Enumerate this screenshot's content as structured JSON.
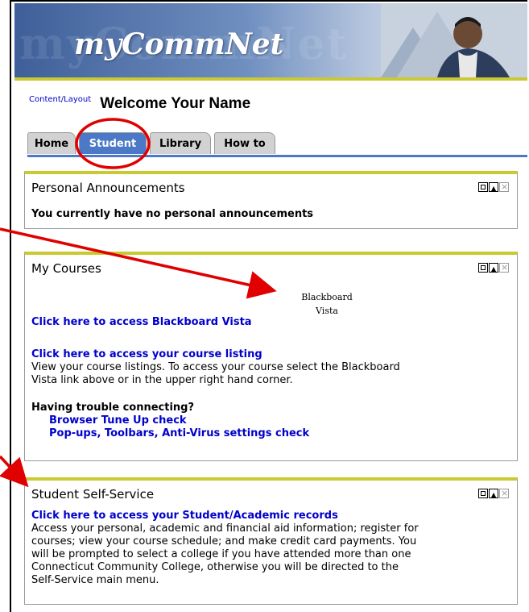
{
  "header": {
    "logo_text": "myCommNet",
    "ghost_text": "myCommNet"
  },
  "welcome": {
    "content_layout_link": "Content/Layout",
    "greeting": "Welcome  Your Name"
  },
  "tabs": [
    {
      "label": "Home",
      "active": false
    },
    {
      "label": "Student",
      "active": true
    },
    {
      "label": "Library",
      "active": false
    },
    {
      "label": "How to",
      "active": false
    }
  ],
  "portlets": {
    "announcements": {
      "title": "Personal Announcements",
      "message": "You currently have no personal announcements"
    },
    "courses": {
      "title": "My Courses",
      "blackboard_image_text": "Blackboard Vista",
      "blackboard_link": "Click here to access Blackboard Vista",
      "listing_link": "Click here to access your course listing",
      "listing_desc_1": "View your course listings. To access your course select the Blackboard",
      "listing_desc_2": "Vista link above or in the upper right hand corner.",
      "trouble_heading": "Having trouble connecting?",
      "tune_up_link": "Browser Tune Up check",
      "popups_link": "Pop-ups, Toolbars, Anti-Virus settings check"
    },
    "selfservice": {
      "title": "Student Self-Service",
      "records_link": "Click here to access your Student/Academic records",
      "desc_lines": [
        "Access your personal, academic and financial aid information; register for",
        "courses; view your course schedule; and make credit card payments. You",
        "will be prompted to select a college if you have attended more than one",
        "Connecticut Community College, otherwise you will be directed to the",
        "Self-Service main menu."
      ]
    }
  },
  "colors": {
    "accent_blue": "#4b79c8",
    "portlet_top": "#c9c932",
    "link": "#0000cc",
    "annotation_red": "#e00000"
  }
}
